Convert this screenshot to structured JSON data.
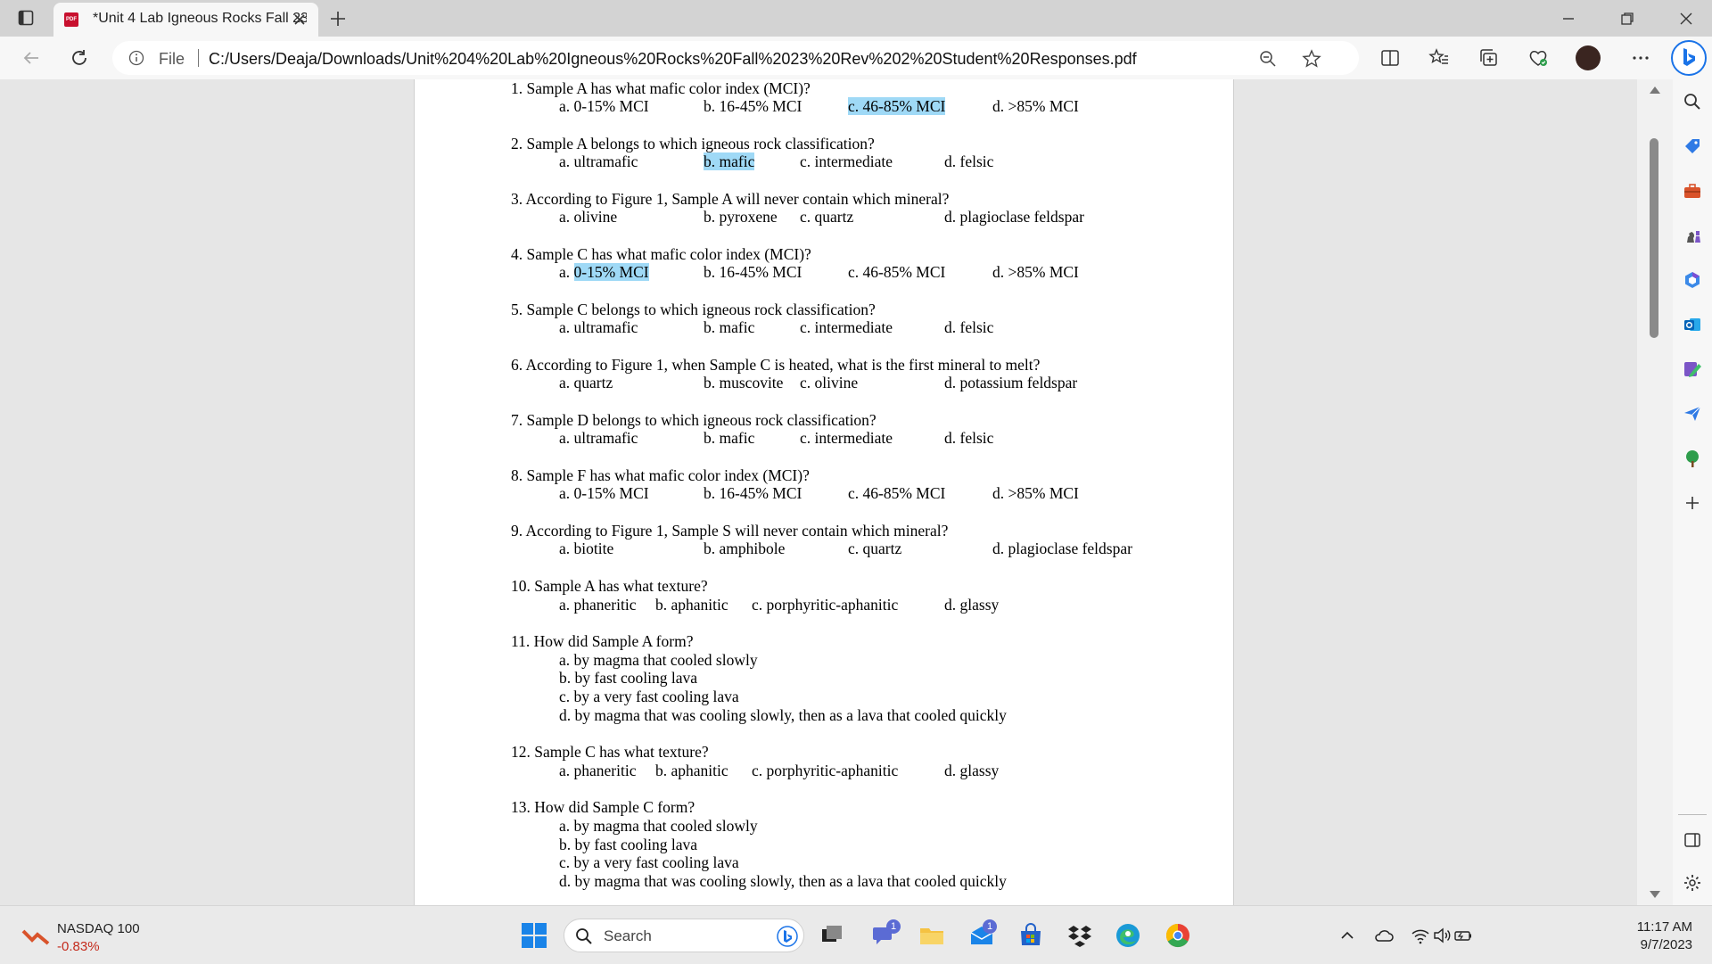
{
  "browser": {
    "tab_title": "*Unit 4 Lab Igneous Rocks Fall 23",
    "file_label": "File",
    "url": "C:/Users/Deaja/Downloads/Unit%204%20Lab%20Igneous%20Rocks%20Fall%2023%20Rev%202%20Student%20Responses.pdf"
  },
  "questions": [
    {
      "prompt": "1. Sample A has what mafic color index (MCI)?",
      "options": [
        "a. 0-15% MCI",
        "b. 16-45% MCI",
        "c. 46-85% MCI",
        "d. >85% MCI"
      ],
      "highlight": 2
    },
    {
      "prompt": "2. Sample A belongs to which igneous rock classification?",
      "options": [
        "a. ultramafic",
        "b. mafic",
        "c. intermediate",
        "d. felsic"
      ],
      "highlight": 1
    },
    {
      "prompt": "3. According to Figure 1, Sample A will never contain which mineral?",
      "options": [
        "a. olivine",
        "b. pyroxene",
        "c. quartz",
        "d. plagioclase feldspar"
      ],
      "highlight": -1
    },
    {
      "prompt": "4. Sample C has what mafic color index (MCI)?",
      "options": [
        "a. 0-15% MCI",
        "b. 16-45% MCI",
        "c. 46-85% MCI",
        "d. >85% MCI"
      ],
      "highlight": 0
    },
    {
      "prompt": "5. Sample C belongs to which igneous rock classification?",
      "options": [
        "a. ultramafic",
        "b. mafic",
        "c. intermediate",
        "d. felsic"
      ],
      "highlight": -1
    },
    {
      "prompt": "6. According to Figure 1, when Sample C is heated, what is the first mineral to melt?",
      "options": [
        "a. quartz",
        "b. muscovite",
        "c. olivine",
        "d. potassium feldspar"
      ],
      "highlight": -1
    },
    {
      "prompt": "7. Sample D belongs to which igneous rock classification?",
      "options": [
        "a. ultramafic",
        "b. mafic",
        "c. intermediate",
        "d. felsic"
      ],
      "highlight": -1
    },
    {
      "prompt": "8. Sample F has what mafic color index (MCI)?",
      "options": [
        "a. 0-15% MCI",
        "b. 16-45% MCI",
        "c. 46-85% MCI",
        "d. >85% MCI"
      ],
      "highlight": -1
    },
    {
      "prompt": "9. According to Figure 1, Sample S will never contain which mineral?",
      "options": [
        "a. biotite",
        "b. amphibole",
        "c. quartz",
        "d. plagioclase feldspar"
      ],
      "highlight": -1
    },
    {
      "prompt": "10. Sample A has what texture?",
      "options": [
        "a. phaneritic",
        "b. aphanitic",
        "c. porphyritic-aphanitic",
        "d. glassy"
      ],
      "highlight": -1
    },
    {
      "prompt": "11. How did Sample A form?",
      "options": [
        "a. by magma that cooled slowly",
        "b. by fast cooling lava",
        "c. by a very fast cooling lava",
        "d. by magma that was cooling slowly, then as a lava that cooled quickly"
      ],
      "highlight": -1
    },
    {
      "prompt": "12. Sample C has what texture?",
      "options": [
        "a. phaneritic",
        "b. aphanitic",
        "c. porphyritic-aphanitic",
        "d. glassy"
      ],
      "highlight": -1
    },
    {
      "prompt": "13. How did Sample C form?",
      "options": [
        "a. by magma that cooled slowly",
        "b. by fast cooling lava",
        "c. by a very fast cooling lava",
        "d. by magma that was cooling slowly, then as a lava that cooled quickly"
      ],
      "highlight": -1
    }
  ],
  "taskbar": {
    "stock_name": "NASDAQ 100",
    "stock_change": "-0.83%",
    "search_label": "Search",
    "teams_badge": "1",
    "mail_badge": "1",
    "time": "11:17 AM",
    "date": "9/7/2023"
  },
  "colors": {
    "highlight": "#9fd9f6",
    "edge_accent": "#1a73e8",
    "stock_down": "#c42b1c"
  }
}
